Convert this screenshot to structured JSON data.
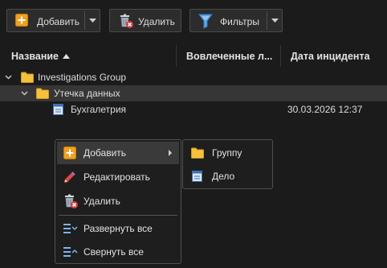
{
  "toolbar": {
    "add_label": "Добавить",
    "delete_label": "Удалить",
    "filters_label": "Фильтры"
  },
  "columns": {
    "name": "Название",
    "involved": "Вовлеченные л...",
    "incident_date": "Дата инцидента"
  },
  "tree": [
    {
      "label": "Investigations Group",
      "type": "folder",
      "expanded": true,
      "date": ""
    },
    {
      "label": "Утечка данных",
      "type": "folder",
      "expanded": true,
      "selected": true,
      "date": ""
    },
    {
      "label": "Бухгалетрия",
      "type": "case",
      "date": "30.03.2026 12:37"
    }
  ],
  "context_menu": {
    "items": [
      {
        "label": "Добавить",
        "icon": "plus-icon",
        "submenu": true
      },
      {
        "label": "Редактировать",
        "icon": "pencil-icon"
      },
      {
        "label": "Удалить",
        "icon": "trash-icon"
      },
      {
        "label": "Развернуть все",
        "icon": "expand-all-icon"
      },
      {
        "label": "Свернуть все",
        "icon": "collapse-all-icon"
      }
    ]
  },
  "submenu": {
    "items": [
      {
        "label": "Группу",
        "icon": "folder-icon"
      },
      {
        "label": "Дело",
        "icon": "case-file-icon"
      }
    ]
  },
  "colors": {
    "background": "#1b1b1b",
    "accent_orange": "#f0a020",
    "folder_yellow": "#f4c13e",
    "filter_blue": "#5ea8e8",
    "delete_red": "#d83a3a"
  }
}
